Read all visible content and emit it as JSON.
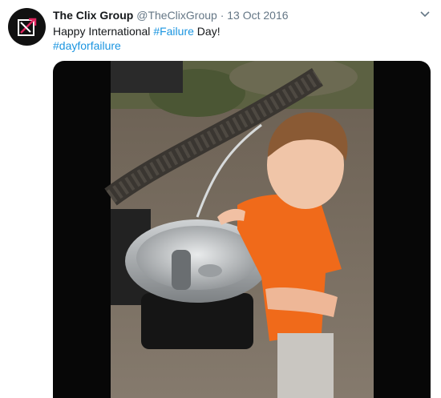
{
  "tweet": {
    "author_name": "The Clix Group",
    "handle": "@TheClixGroup",
    "separator": "·",
    "date": "13 Oct 2016",
    "text_before": "Happy International ",
    "hashtag_inline": "#Failure",
    "text_after": " Day!",
    "hashtag_line2": "#dayforfailure"
  },
  "icons": {
    "avatar": "clix-logo-icon",
    "menu": "chevron-down-icon"
  },
  "colors": {
    "link": "#1b95e0",
    "muted": "#657786",
    "shirt": "#f06a1a"
  }
}
